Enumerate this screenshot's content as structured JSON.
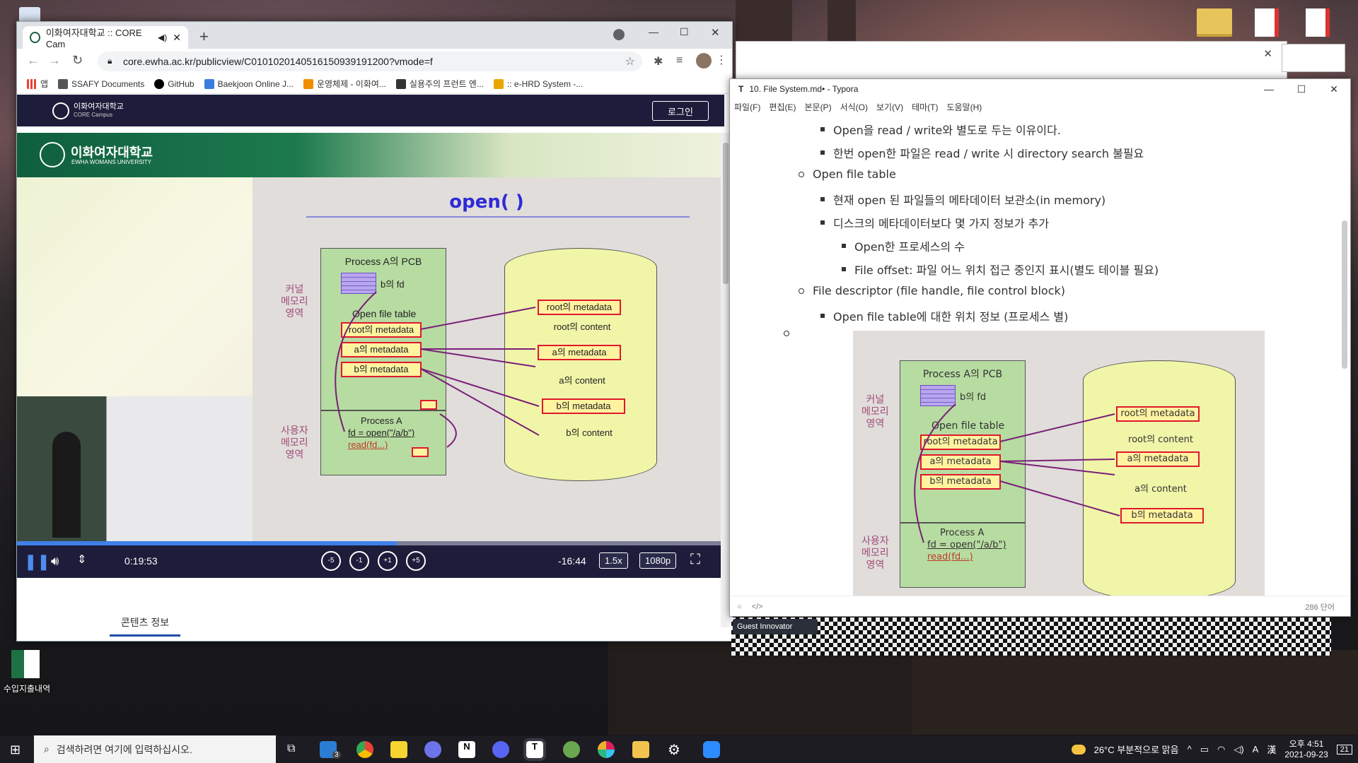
{
  "desktop": {
    "icon_label": "수입지출내역",
    "guest_label": "Guest Innovator"
  },
  "chrome": {
    "tab_title": "이화여자대학교 :: CORE Cam",
    "url": "core.ewha.ac.kr/publicview/C0101020140516150939191200?vmode=f",
    "bookmarks": [
      "앱",
      "SSAFY Documents",
      "GitHub",
      "Baekjoon Online J...",
      "운영체제 - 이화여...",
      "실용주의 프런트 엔...",
      ":: e-HRD System -..."
    ],
    "bookmark_colors": [
      "#e84335",
      "#555555",
      "#000000",
      "#3b7ddd",
      "#f28c00",
      "#333333",
      "#e8a600"
    ]
  },
  "site": {
    "logo_text": "이화여자대학교",
    "logo_sub": "CORE Campus",
    "login_label": "로그인",
    "content_tab": "콘텐츠 정보"
  },
  "slide": {
    "university": "이화여자대학교",
    "university_en": "EWHA WOMANS UNIVERSITY",
    "title": "open( )",
    "pcb_label": "Process A의 PCB",
    "fd_label": "b의 fd",
    "oft_label": "Open file table",
    "kernel_label": "커널\n메모리\n영역",
    "user_label": "사용자\n메모리\n영역",
    "oft_rows": [
      "root의 metadata",
      "a의 metadata",
      "b의 metadata"
    ],
    "process_label": "Process A",
    "code_line1": "fd = open(\"/a/b\")",
    "code_line2": "read(fd...)",
    "disk_rows": [
      "root의 metadata",
      "root의 content",
      "a의 metadata",
      "a의 content",
      "b의 metadata",
      "b의 content"
    ]
  },
  "player": {
    "elapsed": "0:19:53",
    "remaining": "-16:44",
    "speed": "1.5x",
    "quality": "1080p",
    "progress": 0.54,
    "skip_buttons": [
      "-5",
      "-1",
      "+1",
      "+5"
    ]
  },
  "typora": {
    "title": "10. File System.md• - Typora",
    "menu": [
      "파일(F)",
      "편집(E)",
      "본문(P)",
      "서식(O)",
      "보기(V)",
      "테마(T)",
      "도움말(H)"
    ],
    "lines": [
      {
        "level": 2,
        "text": "Open을 read / write와 별도로 두는 이유이다."
      },
      {
        "level": 2,
        "text": "한번 open한 파일은 read / write 시 directory search 불필요"
      },
      {
        "level": 1,
        "text": "Open file table"
      },
      {
        "level": 2,
        "text": "현재 open 된 파일들의 메타데이터 보관소(in memory)"
      },
      {
        "level": 2,
        "text": "디스크의 메타데이터보다 몇 가지 정보가 추가"
      },
      {
        "level": 3,
        "text": "Open한 프로세스의 수"
      },
      {
        "level": 3,
        "text": "File offset: 파일 어느 위치 접근 중인지 표시(별도 테이블 필요)"
      },
      {
        "level": 1,
        "text": "File descriptor (file handle, file control block)"
      },
      {
        "level": 2,
        "text": "Open file table에 대한 위치 정보 (프로세스 별)"
      },
      {
        "level": 1,
        "text": ""
      }
    ],
    "word_count": "286 단어"
  },
  "taskbar": {
    "search_placeholder": "검색하려면 여기에 입력하십시오.",
    "weather": "26°C 부분적으로 맑음",
    "time": "오후 4:51",
    "date": "2021-09-23",
    "notification_count": "21",
    "mail_badge": "3",
    "ime": "A",
    "ime_lang": "漢"
  }
}
